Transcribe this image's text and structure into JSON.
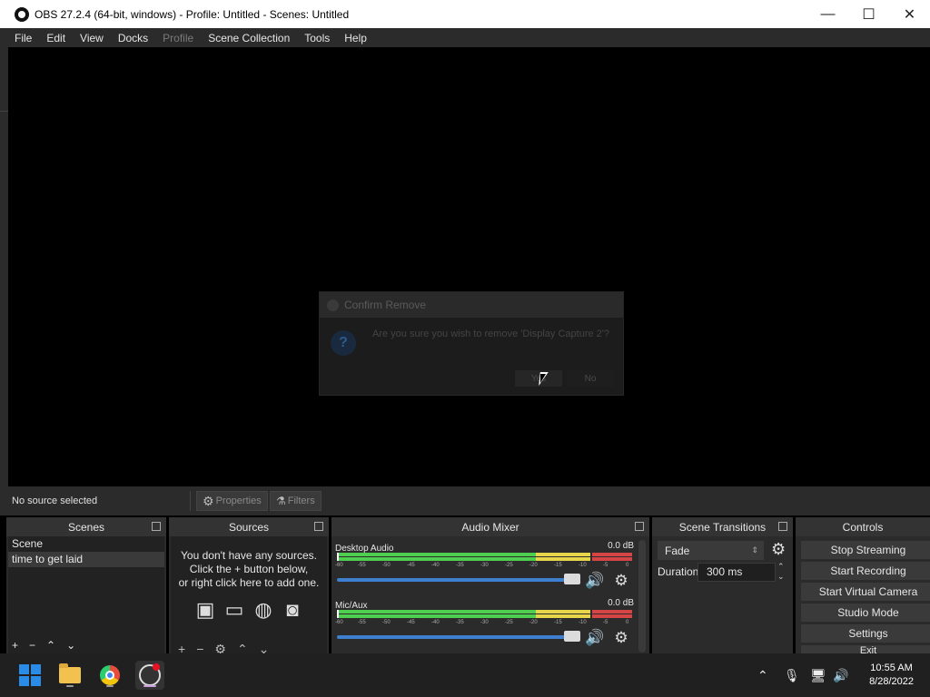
{
  "window": {
    "title": "OBS 27.2.4 (64-bit, windows) - Profile: Untitled - Scenes: Untitled",
    "minimize": "—",
    "maximize": "☐",
    "close": "✕"
  },
  "menu": [
    "File",
    "Edit",
    "View",
    "Docks",
    "Profile",
    "Scene Collection",
    "Tools",
    "Help"
  ],
  "dialog": {
    "title": "Confirm Remove",
    "message": "Are you sure you wish to remove 'Display Capture 2'?",
    "yes_label": "Yes",
    "no_label": "No"
  },
  "status": {
    "no_source": "No source selected",
    "properties_label": "Properties",
    "filters_label": "Filters"
  },
  "scenes": {
    "title": "Scenes",
    "items": [
      "Scene",
      "time to get laid"
    ]
  },
  "sources": {
    "title": "Sources",
    "empty_line1": "You don't have any sources.",
    "empty_line2": "Click the + button below,",
    "empty_line3": "or right click here to add one."
  },
  "mixer": {
    "title": "Audio Mixer",
    "channels": [
      {
        "name": "Desktop Audio",
        "db": "0.0 dB"
      },
      {
        "name": "Mic/Aux",
        "db": "0.0 dB"
      }
    ],
    "ticks": [
      "-60",
      "-55",
      "-50",
      "-45",
      "-40",
      "-35",
      "-30",
      "-25",
      "-20",
      "-15",
      "-10",
      "-5",
      "0"
    ]
  },
  "transitions": {
    "title": "Scene Transitions",
    "selected": "Fade",
    "duration_label": "Duration",
    "duration_value": "300 ms"
  },
  "controls": {
    "title": "Controls",
    "stop_streaming": "Stop Streaming",
    "start_recording": "Start Recording",
    "start_virtual_camera": "Start Virtual Camera",
    "studio_mode": "Studio Mode",
    "settings": "Settings",
    "exit": "Exit"
  },
  "taskbar": {
    "time": "10:55 AM",
    "date": "8/28/2022"
  }
}
